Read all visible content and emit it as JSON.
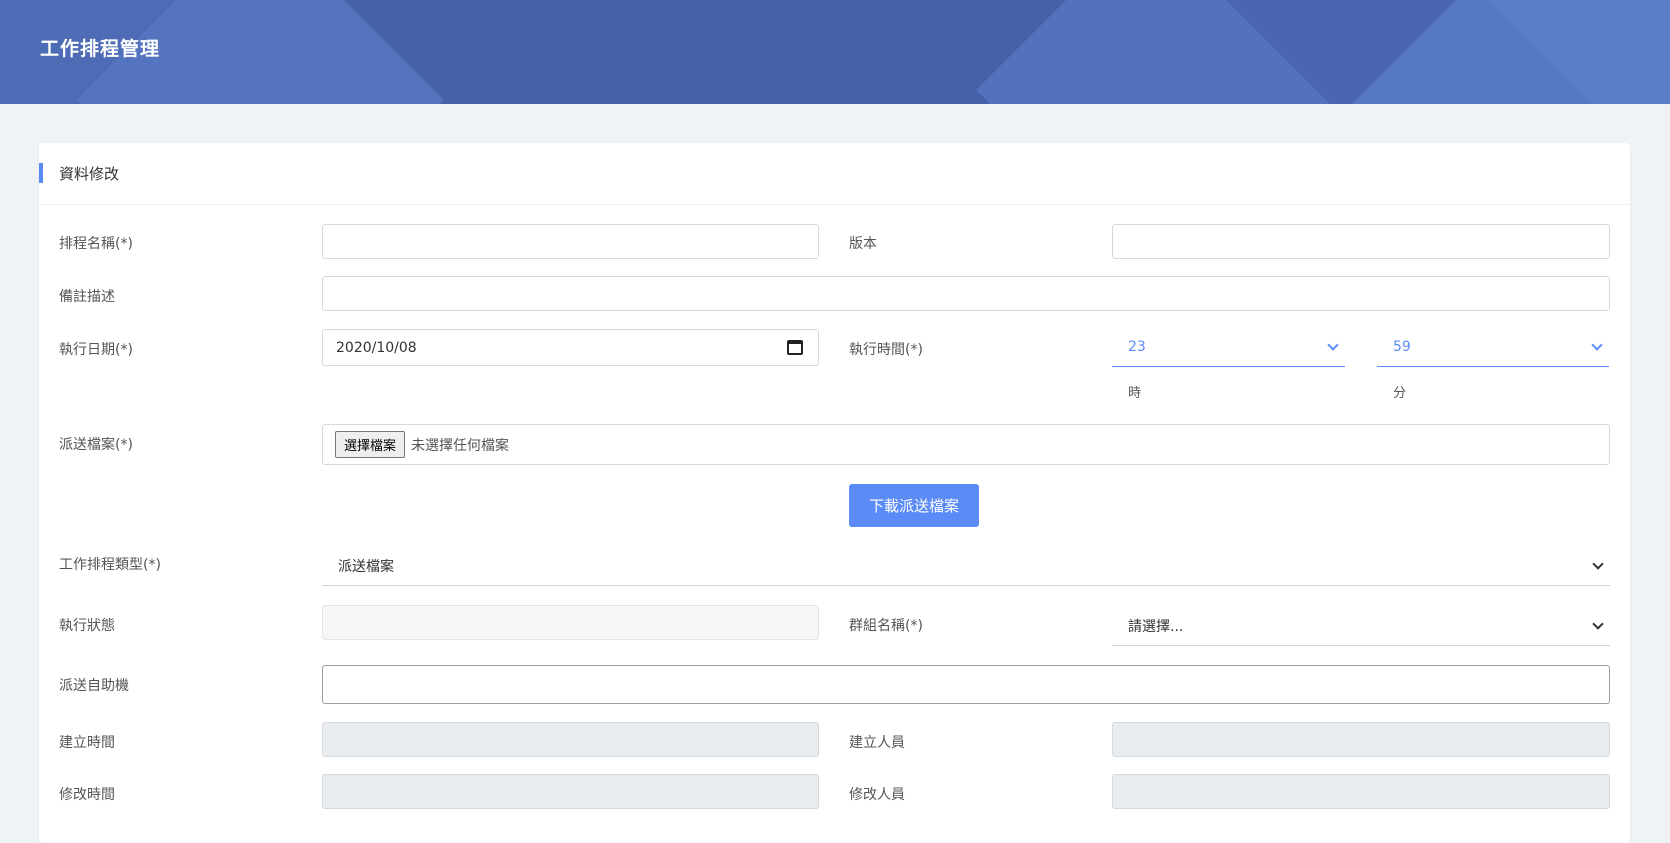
{
  "header": {
    "title": "工作排程管理"
  },
  "card": {
    "title": "資料修改"
  },
  "form": {
    "schedule_name_label": "排程名稱(*)",
    "schedule_name_value": "",
    "version_label": "版本",
    "version_value": "",
    "remark_label": "備註描述",
    "remark_value": "",
    "exec_date_label": "執行日期(*)",
    "exec_date_value": "2020/10/08",
    "exec_time_label": "執行時間(*)",
    "hour_value": "23",
    "hour_unit": "時",
    "minute_value": "59",
    "minute_unit": "分",
    "dispatch_file_label": "派送檔案(*)",
    "choose_file_label": "選擇檔案",
    "no_file_text": "未選擇任何檔案",
    "download_button": "下載派送檔案",
    "job_type_label": "工作排程類型(*)",
    "job_type_value": "派送檔案",
    "exec_status_label": "執行狀態",
    "exec_status_value": "",
    "group_name_label": "群組名稱(*)",
    "group_name_value": "請選擇...",
    "kiosk_label": "派送自助機",
    "kiosk_value": "",
    "created_time_label": "建立時間",
    "created_time_value": "",
    "created_by_label": "建立人員",
    "created_by_value": "",
    "modified_time_label": "修改時間",
    "modified_time_value": "",
    "modified_by_label": "修改人員",
    "modified_by_value": ""
  },
  "colors": {
    "header_bg": "#4661a8",
    "accent": "#5b8bf7",
    "page_bg": "#f0f3f6"
  },
  "icons": {
    "date_picker": "calendar-icon",
    "dropdown": "chevron-down-icon"
  }
}
